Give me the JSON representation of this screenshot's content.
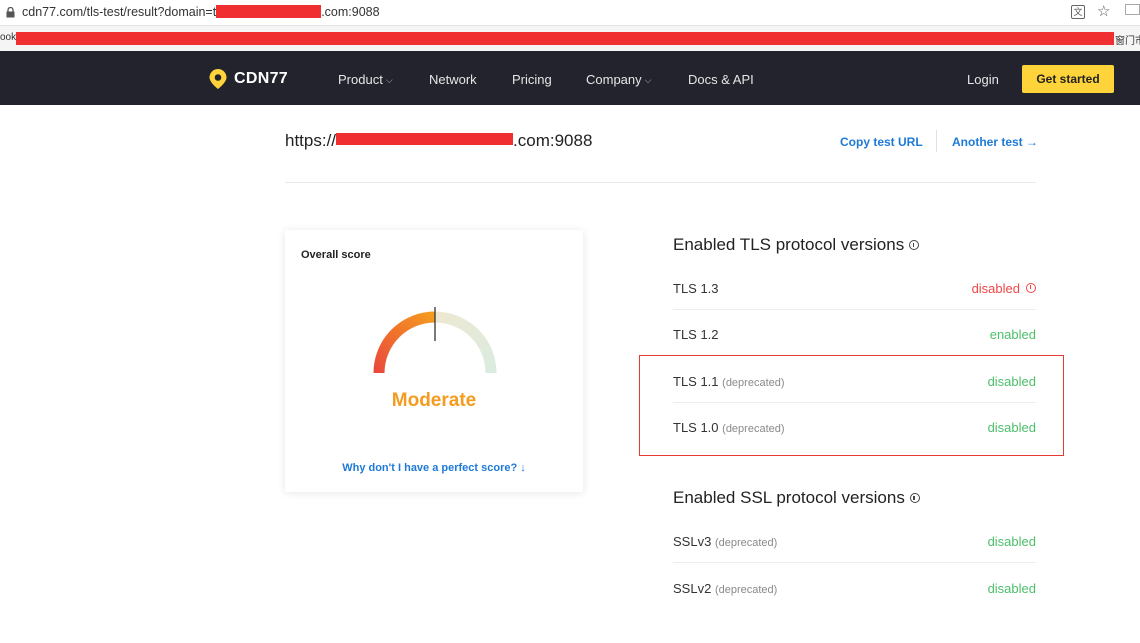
{
  "browser": {
    "url_prefix": "cdn77.com/tls-test/result?domain=t",
    "url_suffix": ".com:9088",
    "bookmarks_left": "ookr",
    "bookmarks_right": "窗门市"
  },
  "nav": {
    "brand": "CDN77",
    "items": [
      "Product",
      "Network",
      "Pricing",
      "Company",
      "Docs & API"
    ],
    "login": "Login",
    "cta": "Get started"
  },
  "header": {
    "domain_prefix": "https://",
    "domain_suffix": ".com:9088",
    "copy_url": "Copy test URL",
    "another_test": "Another test →"
  },
  "score": {
    "title": "Overall score",
    "label": "Moderate",
    "label_color": "#f39c1f",
    "why_link": "Why don't I have a perfect score? ↓",
    "level": 0.5
  },
  "tls": {
    "title": "Enabled TLS protocol versions",
    "rows": [
      {
        "name": "TLS 1.3",
        "note": "",
        "status": "disabled",
        "tone": "red",
        "warn": true
      },
      {
        "name": "TLS 1.2",
        "note": "",
        "status": "enabled",
        "tone": "green",
        "warn": false
      },
      {
        "name": "TLS 1.1",
        "note": "(deprecated)",
        "status": "disabled",
        "tone": "green",
        "warn": false
      },
      {
        "name": "TLS 1.0",
        "note": "(deprecated)",
        "status": "disabled",
        "tone": "green",
        "warn": false
      }
    ]
  },
  "ssl": {
    "title": "Enabled SSL protocol versions",
    "rows": [
      {
        "name": "SSLv3",
        "note": "(deprecated)",
        "status": "disabled",
        "tone": "green"
      },
      {
        "name": "SSLv2",
        "note": "(deprecated)",
        "status": "disabled",
        "tone": "green"
      }
    ]
  },
  "colors": {
    "accent": "#1d7ad6",
    "nav_bg": "#22232d",
    "cta": "#ffd43b",
    "good": "#4cbf6a",
    "bad": "#f04646"
  }
}
